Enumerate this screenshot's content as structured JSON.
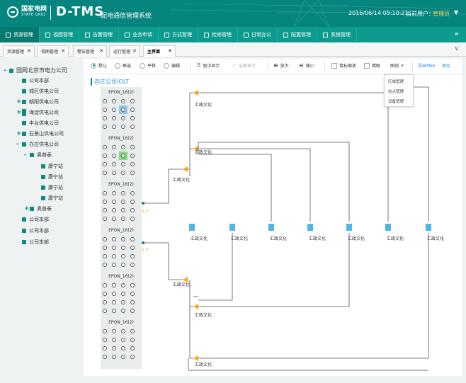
{
  "header": {
    "logo_cn": "国家电网",
    "logo_en": "STATE GRID",
    "brand": "D-TMS",
    "brand_sub": "配电通信管理系统",
    "datetime": "2016/06/14 09:10:21",
    "user_label": "当前用户：",
    "user_name": "管理员",
    "colors": {
      "header_bg": "#06857f",
      "nav_bg": "#0e9b8f",
      "accent": "#0e8a80",
      "highlight": "#f7d34c"
    }
  },
  "nav": {
    "items": [
      {
        "label": "资源管理",
        "icon": "database-icon",
        "active": true
      },
      {
        "label": "视图管理",
        "icon": "grid-icon",
        "active": false
      },
      {
        "label": "告警管理",
        "icon": "bell-icon",
        "active": false
      },
      {
        "label": "业务申请",
        "icon": "flame-icon",
        "active": false
      },
      {
        "label": "方式管理",
        "icon": "swap-icon",
        "active": false
      },
      {
        "label": "检修管理",
        "icon": "wrench-icon",
        "active": false
      },
      {
        "label": "日常办公",
        "icon": "person-icon",
        "active": false
      },
      {
        "label": "配置管理",
        "icon": "gear-icon",
        "active": false
      },
      {
        "label": "系统管理",
        "icon": "grid-icon",
        "active": false
      }
    ],
    "more_icon": "double-chevron-right-icon"
  },
  "tabs": [
    {
      "label": "资源管理",
      "active": false
    },
    {
      "label": "视图管理",
      "active": false
    },
    {
      "label": "警告管理",
      "active": false
    },
    {
      "label": "运行管理",
      "active": false
    },
    {
      "label": "主界面",
      "active": true
    }
  ],
  "tree": [
    {
      "label": "国网北京市电力公司",
      "toggle": "-",
      "level": 0
    },
    {
      "label": "公司本部",
      "toggle": "",
      "level": 1
    },
    {
      "label": "城区供电公司",
      "toggle": "",
      "level": 1
    },
    {
      "label": "朝阳供电公司",
      "toggle": "+",
      "level": 1
    },
    {
      "label": "海淀供电公司",
      "toggle": "+",
      "level": 1
    },
    {
      "label": "丰台供电公司",
      "toggle": "",
      "level": 1
    },
    {
      "label": "石景山供电公司",
      "toggle": "+",
      "level": 1
    },
    {
      "label": "亦庄供电公司",
      "toggle": "-",
      "level": 1
    },
    {
      "label": "奥普泰",
      "toggle": "-",
      "level": 2
    },
    {
      "label": "康宁站",
      "toggle": "",
      "level": 3
    },
    {
      "label": "康宁站",
      "toggle": "",
      "level": 3
    },
    {
      "label": "康宁站",
      "toggle": "",
      "level": 3
    },
    {
      "label": "康宁站",
      "toggle": "",
      "level": 3
    },
    {
      "label": "奥普泰",
      "toggle": "+",
      "level": 2
    },
    {
      "label": "公司本部",
      "toggle": "",
      "level": 1
    },
    {
      "label": "公司本部",
      "toggle": "",
      "level": 1
    },
    {
      "label": "公司本部",
      "toggle": "",
      "level": 1
    }
  ],
  "toolbar": {
    "radio_default": "默认",
    "radio_select": "框选",
    "radio_pan": "平移",
    "radio_edit": "编辑",
    "center": "居中显示",
    "fullscreen": "全屏显示",
    "zoom_in": "放大",
    "zoom_out": "缩小",
    "mouse_zoom": "鼠标缩放",
    "eagle": "鹰眼",
    "legend": "图例",
    "export": "导出PNG",
    "save": "保存"
  },
  "legend_menu": [
    "区域管理",
    "站点管理",
    "设备管理"
  ],
  "breadcrumb": "亦庄公司/OLT",
  "olt": {
    "card_title": "EPON_16(2)",
    "cards": 6,
    "port_label_a": "2-7",
    "port_label_b": "2-7"
  },
  "diagram": {
    "node_label": "汇政文化"
  }
}
